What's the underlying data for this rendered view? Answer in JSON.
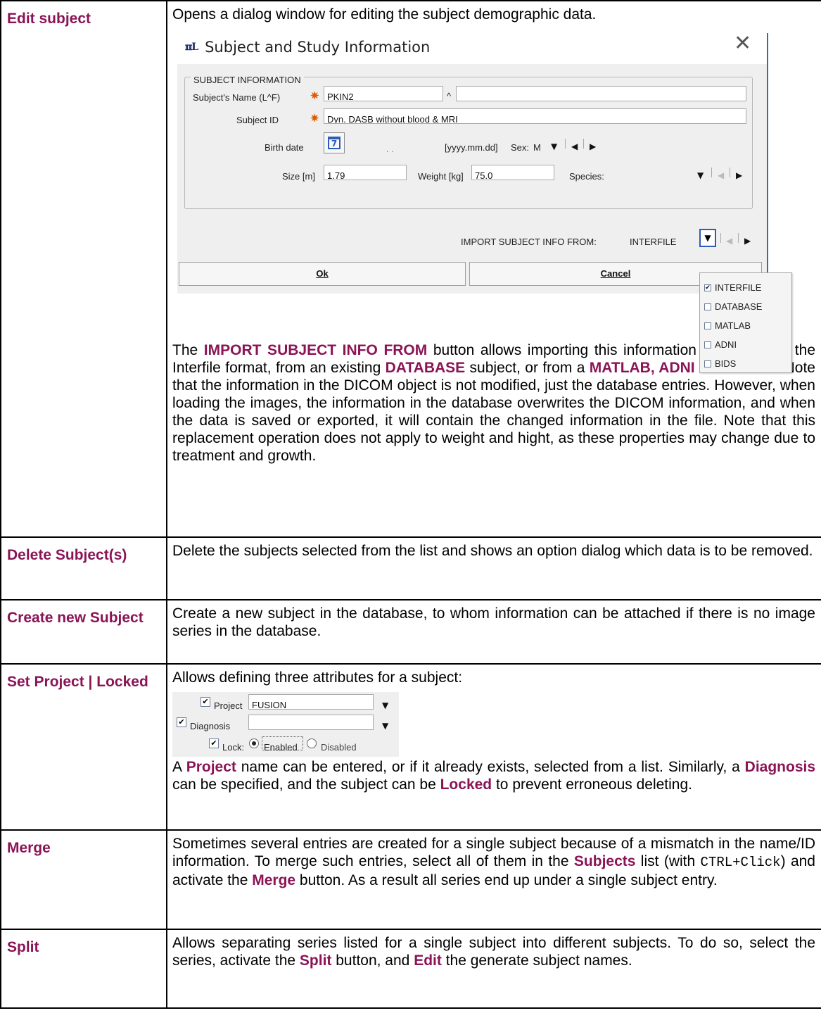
{
  "rows": [
    {
      "term": "Edit subject",
      "intro": "Opens a dialog window for editing the subject demographic data.",
      "dialog": {
        "title": "Subject and Study Information",
        "app_icon": "PMOD-icon",
        "section_legend": "SUBJECT INFORMATION",
        "name_label": "Subject's Name (L^F)",
        "name_value": "PKIN2",
        "name_sep": "^",
        "name_value2": "",
        "id_label": "Subject ID",
        "id_value": "Dyn. DASB without blood & MRI",
        "birth_label": "Birth date",
        "birth_value": ".          .",
        "birth_format": "[yyyy.mm.dd]",
        "sex_label": "Sex:",
        "sex_value": "M",
        "size_label": "Size [m]",
        "size_value": "1.79",
        "weight_label": "Weight [kg]",
        "weight_value": "75.0",
        "species_label": "Species:",
        "import_label": "IMPORT SUBJECT INFO FROM:",
        "import_value": "INTERFILE",
        "ok_label": "Ok",
        "cancel_label": "Cancel",
        "import_options": [
          {
            "label": "INTERFILE",
            "checked": true
          },
          {
            "label": "DATABASE",
            "checked": false
          },
          {
            "label": "MATLAB",
            "checked": false
          },
          {
            "label": "ADNI",
            "checked": false
          },
          {
            "label": "BIDS",
            "checked": false
          }
        ]
      },
      "p_before1": "The ",
      "p_hl1": "IMPORT SUBJECT INFO FROM",
      "p_mid1": " button allows importing this information from a file in the Interfile format, from an existing ",
      "p_hl2": "DATABASE",
      "p_mid2": " subject, or from a ",
      "p_hl3": "MATLAB, ADNI or BIDs",
      "p_after": " file. Note that the information in the DICOM object is not modified, just the database entries. However, when loading the images, the information in the database overwrites the DICOM information, and when the data is saved or exported, it will contain the changed information in the file. Note that this replacement operation does not apply to weight and hight, as these properties may change due to treatment and growth."
    },
    {
      "term": "Delete Subject(s)",
      "text": "Delete the subjects selected from the list and shows an option dialog which data is to be removed."
    },
    {
      "term": "Create new Subject",
      "text": "Create a new subject in the database, to whom information can be attached if there is no image series in the database."
    },
    {
      "term": "Set Project | Locked",
      "intro": "Allows defining three attributes for a subject:",
      "widget": {
        "project_label": "Project",
        "project_value": "FUSION",
        "diagnosis_label": "Diagnosis",
        "diagnosis_value": "",
        "lock_label": "Lock:",
        "enabled_label": "Enabled",
        "disabled_label": "Disabled",
        "lock_selected": "Enabled"
      },
      "p1": "A ",
      "hl1": "Project",
      "p2": " name can be entered, or if it already exists, selected from a list. Similarly, a ",
      "hl2": "Diagnosis",
      "p3": " can be specified, and the subject can be ",
      "hl3": "Locked",
      "p4": " to prevent erroneous deleting."
    },
    {
      "term": "Merge",
      "p1": "Sometimes several entries are created for a single subject because of a mismatch in the name/ID information. To merge such entries, select all of them in the ",
      "hl1": "Subjects",
      "p2": " list (with ",
      "code": "CTRL+Click",
      "p3": ") and activate the ",
      "hl2": "Merge",
      "p4": " button. As a result all series end up under a single subject entry."
    },
    {
      "term": "Split",
      "p1": "Allows separating series listed for a single subject into different subjects. To do so, select the series, activate the ",
      "hl1": "Split",
      "p2": " button, and ",
      "hl2": "Edit",
      "p3": " the generate subject names."
    }
  ]
}
